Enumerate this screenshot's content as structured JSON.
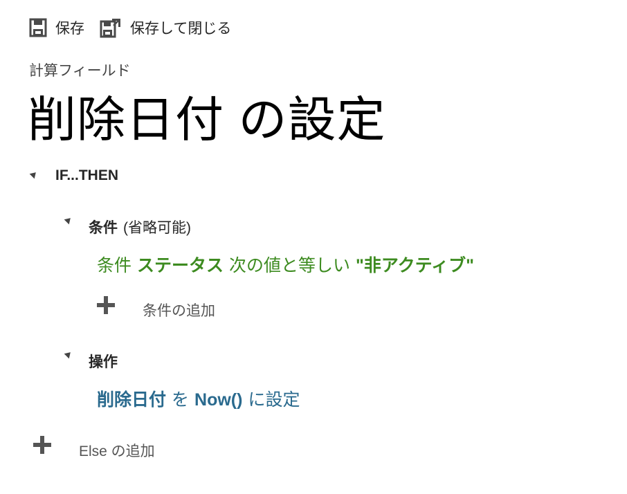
{
  "toolbar": {
    "save_label": "保存",
    "save_close_label": "保存して閉じる",
    "save_icon": "floppy-disk-icon",
    "save_close_icon": "floppy-disk-close-icon"
  },
  "header": {
    "subtitle": "計算フィールド",
    "title": "削除日付 の設定"
  },
  "rule": {
    "if_then_label": "IF...THEN",
    "conditions": {
      "label": "条件",
      "optional_note": "(省略可能)",
      "items": [
        {
          "prefix": "条件",
          "field": "ステータス",
          "operator": "次の値と等しい",
          "value": "\"非アクティブ\""
        }
      ],
      "add_label": "条件の追加"
    },
    "actions": {
      "label": "操作",
      "items": [
        {
          "field": "削除日付",
          "connector": "を",
          "value": "Now()",
          "verb": "に設定"
        }
      ]
    },
    "add_else_label": "Else の追加"
  },
  "colors": {
    "condition_text": "#3d8b20",
    "action_text": "#2a6a8e",
    "title_text": "#000000"
  }
}
